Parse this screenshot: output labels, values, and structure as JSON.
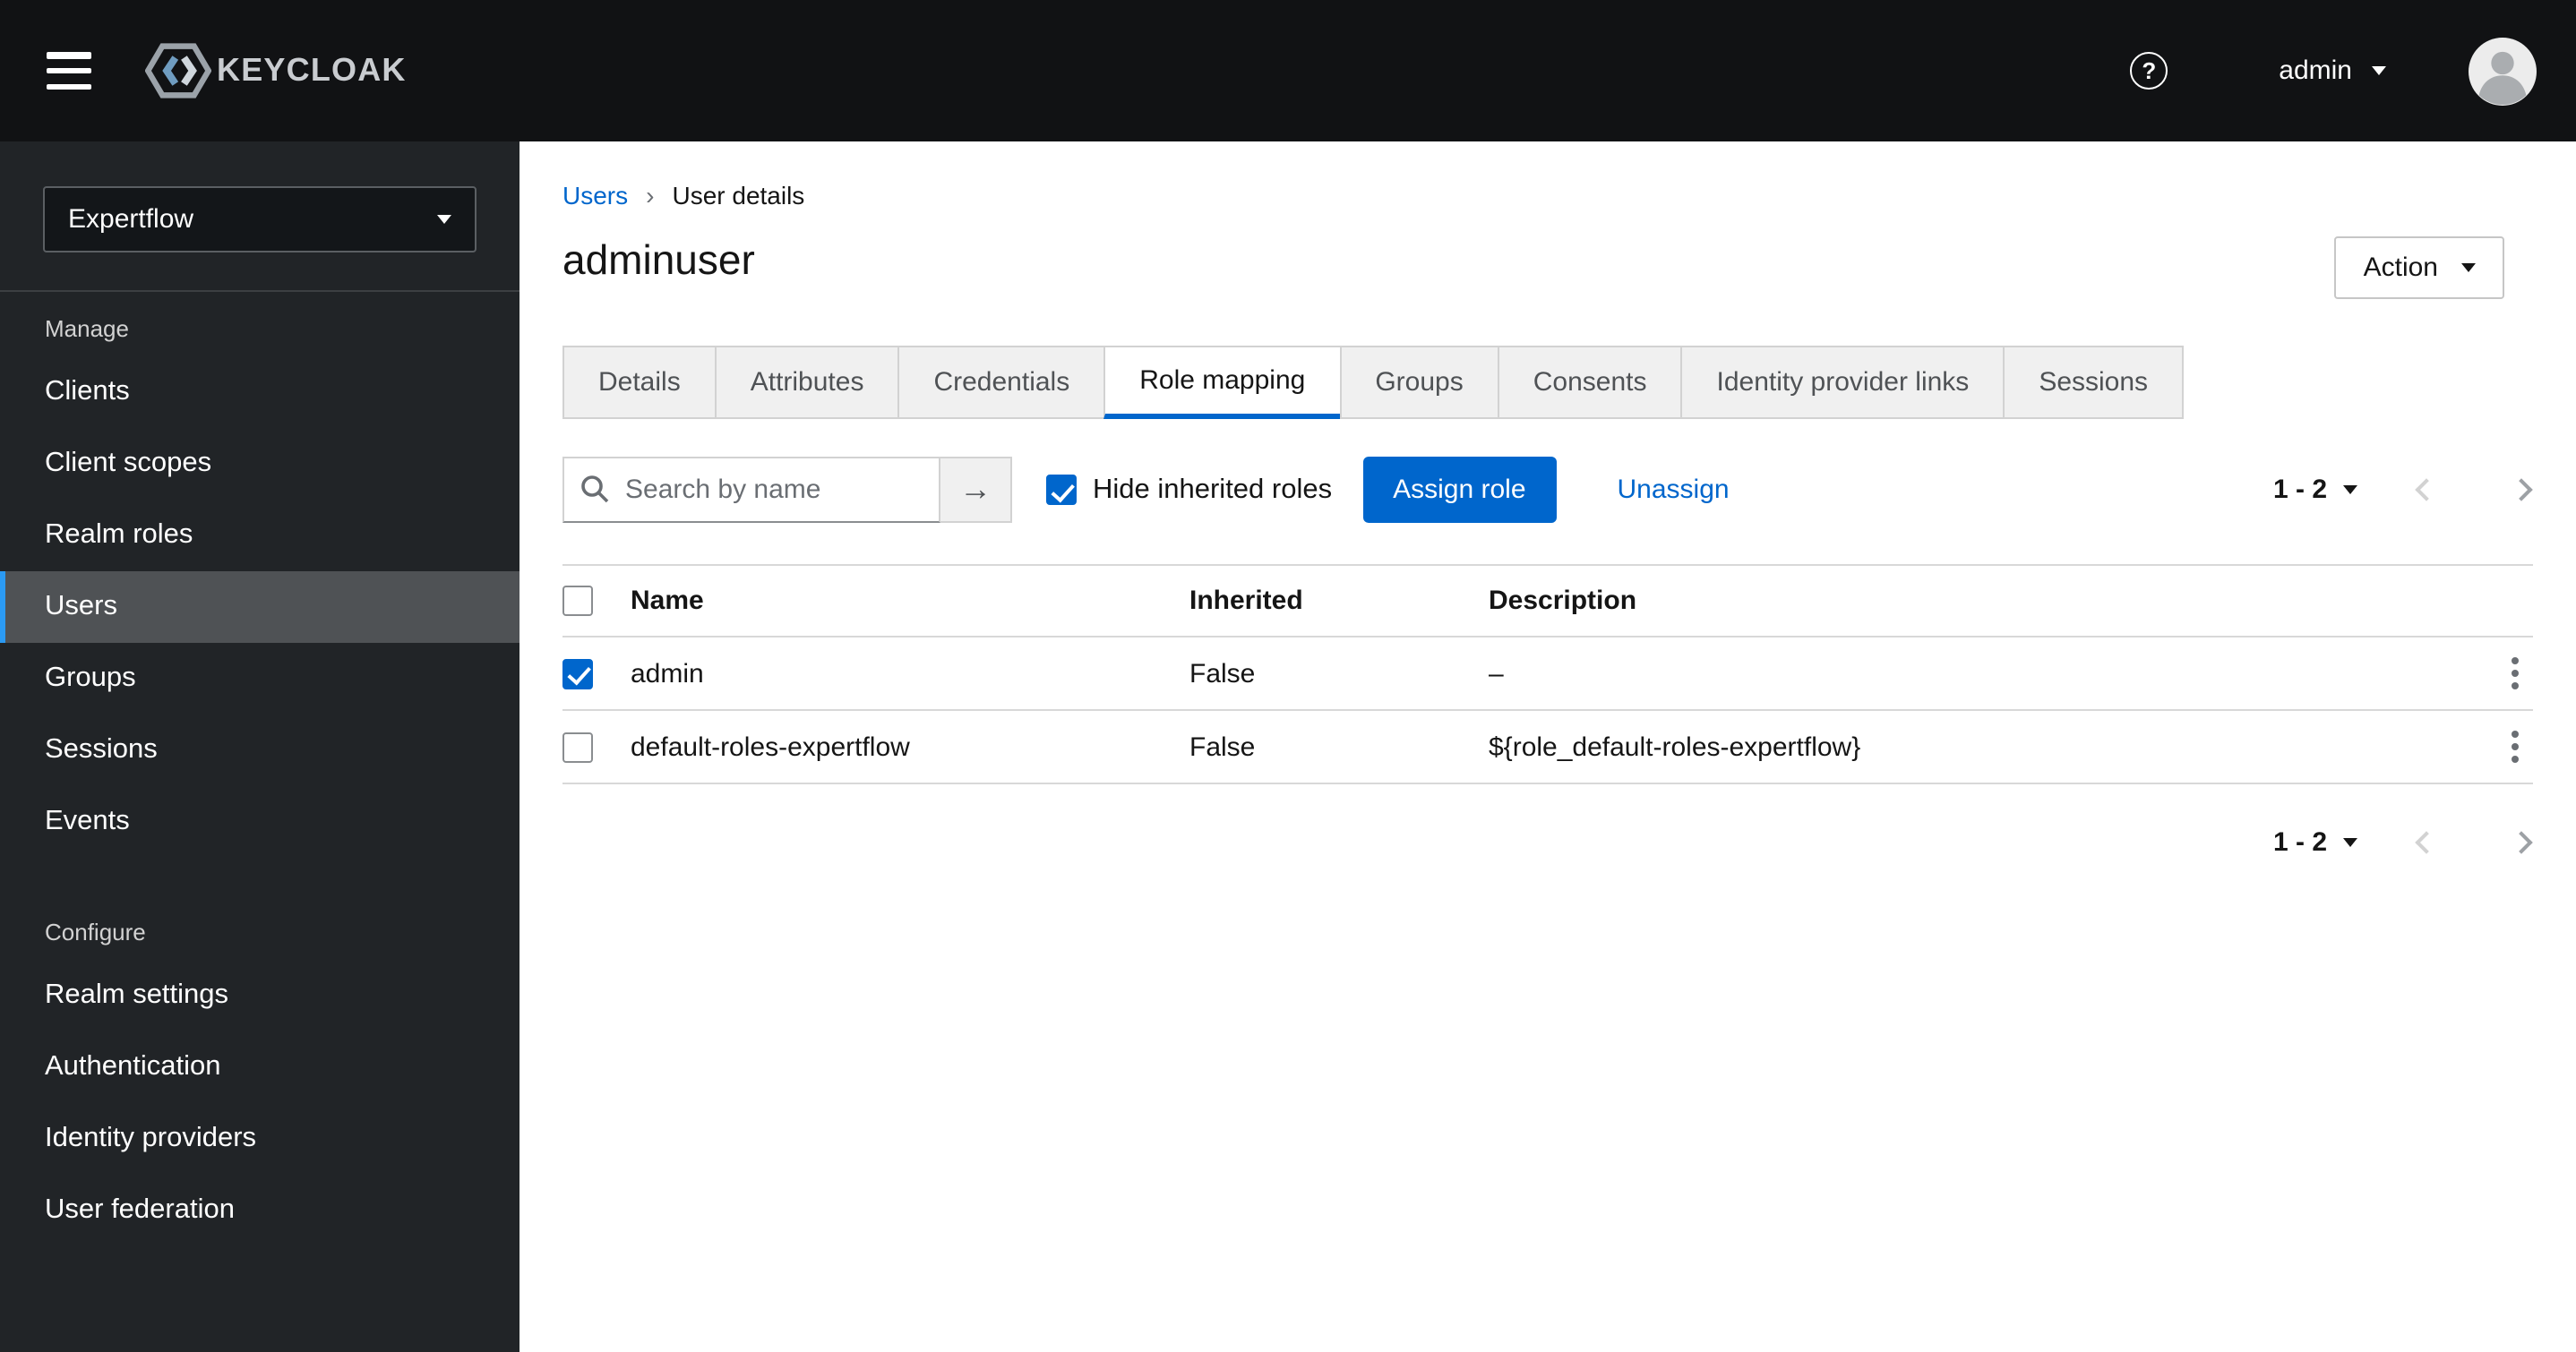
{
  "topbar": {
    "brand": "KEYCLOAK",
    "help_icon": "?",
    "username": "admin"
  },
  "sidebar": {
    "realm": "Expertflow",
    "manage_label": "Manage",
    "manage_items": [
      "Clients",
      "Client scopes",
      "Realm roles",
      "Users",
      "Groups",
      "Sessions",
      "Events"
    ],
    "configure_label": "Configure",
    "configure_items": [
      "Realm settings",
      "Authentication",
      "Identity providers",
      "User federation"
    ],
    "selected_item": "Users"
  },
  "breadcrumb": {
    "root": "Users",
    "separator": "›",
    "current": "User details"
  },
  "page": {
    "title": "adminuser",
    "action_label": "Action"
  },
  "tabs": {
    "items": [
      "Details",
      "Attributes",
      "Credentials",
      "Role mapping",
      "Groups",
      "Consents",
      "Identity provider links",
      "Sessions"
    ],
    "active": "Role mapping"
  },
  "toolbar": {
    "search_placeholder": "Search by name",
    "search_button_icon": "→",
    "hide_inherited_label": "Hide inherited roles",
    "hide_inherited_checked": true,
    "assign_label": "Assign role",
    "unassign_label": "Unassign",
    "pagination": "1 - 2"
  },
  "table": {
    "headers": {
      "name": "Name",
      "inherited": "Inherited",
      "description": "Description"
    },
    "rows": [
      {
        "checked": true,
        "name": "admin",
        "inherited": "False",
        "description": "–"
      },
      {
        "checked": false,
        "name": "default-roles-expertflow",
        "inherited": "False",
        "description": "${role_default-roles-expertflow}"
      }
    ]
  },
  "footer": {
    "pagination": "1 - 2"
  },
  "colors": {
    "primary_blue": "#0066cc",
    "nav_selected_accent": "#2b9af3",
    "sidebar_bg": "#212427",
    "topbar_bg": "#111214"
  }
}
